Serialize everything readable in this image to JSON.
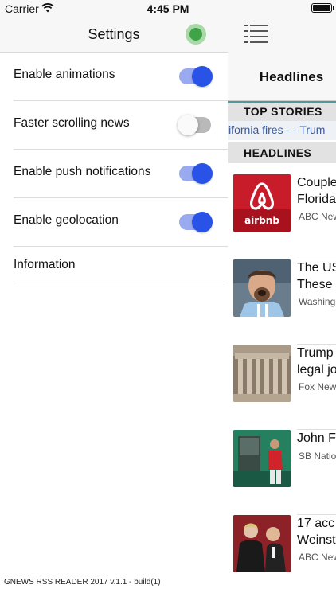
{
  "status_bar": {
    "carrier": "Carrier",
    "time": "4:45 PM"
  },
  "settings": {
    "title": "Settings",
    "items": [
      {
        "label": "Enable animations",
        "enabled": true
      },
      {
        "label": "Faster scrolling news",
        "enabled": false
      },
      {
        "label": "Enable push notifications",
        "enabled": true
      },
      {
        "label": "Enable geolocation",
        "enabled": true
      }
    ],
    "information_label": "Information",
    "footer": "GNEWS RSS READER 2017 v.1.1 - build(1)",
    "accent_color": "#2952e6",
    "status_indicator_color": "#3fa447"
  },
  "news": {
    "title": "Headlines",
    "top_stories_label": "TOP STORIES",
    "ticker_text": "lifornia fires -  - Trum",
    "headlines_label": "HEADLINES",
    "items": [
      {
        "headline": "Couple\nFlorida",
        "source": "ABC New",
        "thumb_icon": "airbnb-logo-thumbnail"
      },
      {
        "headline": "The US\nThese",
        "source": "Washing",
        "thumb_icon": "soccer-player-thumbnail"
      },
      {
        "headline": "Trump\nlegal jo",
        "source": "Fox New",
        "thumb_icon": "courthouse-thumbnail"
      },
      {
        "headline": "John F",
        "source": "SB Natio",
        "thumb_icon": "baseball-dugout-thumbnail"
      },
      {
        "headline": "17 acc\nWeinst",
        "source": "ABC New",
        "thumb_icon": "people-event-thumbnail"
      }
    ]
  }
}
